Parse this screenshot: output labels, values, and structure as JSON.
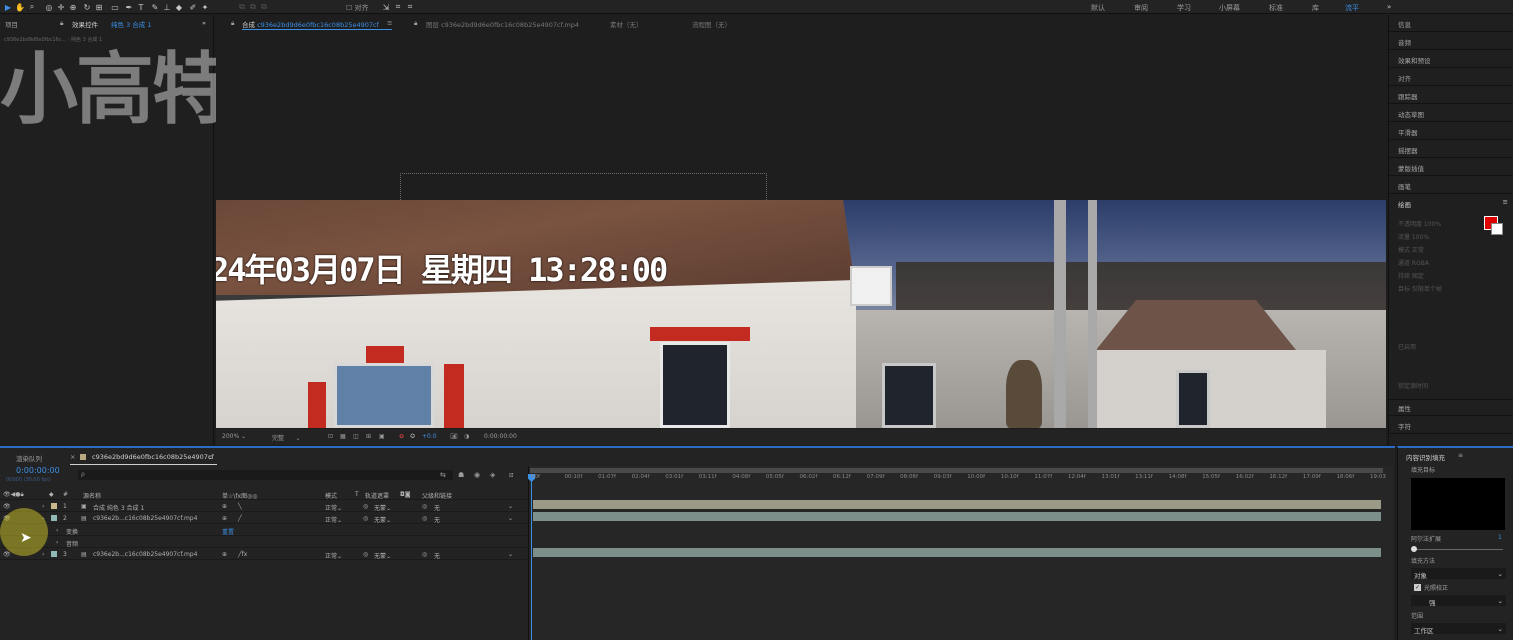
{
  "toolbar": {
    "snap_label": "对齐",
    "workspaces": [
      "默认",
      "审阅",
      "学习",
      "小屏幕",
      "标准",
      "库",
      "流平"
    ],
    "active_workspace": "流平"
  },
  "left_panel": {
    "tab_project": "项目",
    "tab_effects_controls": "效果控件",
    "effects_target": "纯色 3 合成 1",
    "breadcrumb": "c936e2bd9d6e0fbc16c... · 纯色 3 合成 1",
    "watermark": "小高特效"
  },
  "comp_panel": {
    "tab_comp_prefix": "合成",
    "tab_comp_name": "c936e2bd9d6e0fbc16c08b25e4907cf",
    "tab_layer": "图层 c936e2bd9d6e0fbc16c08b25e4907cf.mp4",
    "tab_footage": "素材（无）",
    "tab_flowchart": "流程图（无）"
  },
  "video": {
    "timestamp": "24年03月07日 星期四 13:28:00"
  },
  "viewer_bar": {
    "zoom": "200%",
    "resolution": "完整",
    "exposure": "+0.0",
    "timecode": "0:00:00:00"
  },
  "right_panel": {
    "items": [
      "信息",
      "音频",
      "效果和预设",
      "对齐",
      "跟踪器",
      "动态草图",
      "平滑器",
      "摇摆器",
      "蒙版插值",
      "画笔"
    ],
    "paragraph_header": "绘画",
    "properties": "属性",
    "character": "字符",
    "paint_rows": [
      "不透明度 100%",
      "流量 100%",
      "模式 正常",
      "通道 RGBA",
      "持续 固定",
      "目标 仅限单个帧",
      "已启用",
      "锁定源时间"
    ]
  },
  "render_queue_tab": "渲染队列",
  "timeline": {
    "comp_tab": "c936e2bd9d6e0fbc16c08b25e4907cf",
    "timecode": "0:00:00:00",
    "fps": "00000 (30.00 fps)",
    "search_placeholder": "ρ",
    "headers": {
      "source_name": "源名称",
      "switches": "单☆\\fx图◎◎",
      "mode": "模式",
      "t": "T",
      "trkmat": "轨道遮罩",
      "parent": "父级和链接"
    },
    "layers": [
      {
        "num": "1",
        "name": "合成 纯色 3 合成 1",
        "mode": "正常",
        "trkmat": "无蒙",
        "parent": "无",
        "color": "#c8b88a"
      },
      {
        "num": "2",
        "name": "c936e2b...c16c08b25e4907cf.mp4",
        "mode": "正常",
        "trkmat": "无蒙",
        "parent": "无",
        "color": "#8fb8b8"
      },
      {
        "num": "3",
        "name": "c936e2b...c16c08b25e4907cf.mp4",
        "mode": "正常",
        "trkmat": "无蒙",
        "parent": "无",
        "color": "#8fb8b8"
      }
    ],
    "sub_transform": "变换",
    "sub_transform_value": "重置",
    "sub_audio": "音频",
    "ruler": [
      "00f",
      "00:10f",
      "01:07f",
      "02:04f",
      "03:01f",
      "03:11f",
      "04:08f",
      "05:05f",
      "06:02f",
      "06:12f",
      "07:09f",
      "08:06f",
      "09:03f",
      "10:00f",
      "10:10f",
      "11:07f",
      "12:04f",
      "13:01f",
      "13:11f",
      "14:08f",
      "15:05f",
      "16:02f",
      "16:12f",
      "17:09f",
      "18:06f",
      "19:03"
    ]
  },
  "fill_panel": {
    "title": "内容识别填充",
    "fill_target": "填充目标",
    "alpha_expand": "阿尔法扩展",
    "alpha_value": "1",
    "fill_method": "填充方法",
    "fill_method_value": "对象",
    "lighting_correction": "光照校正",
    "lighting_value": "强",
    "range": "范围",
    "range_value": "工作区"
  }
}
